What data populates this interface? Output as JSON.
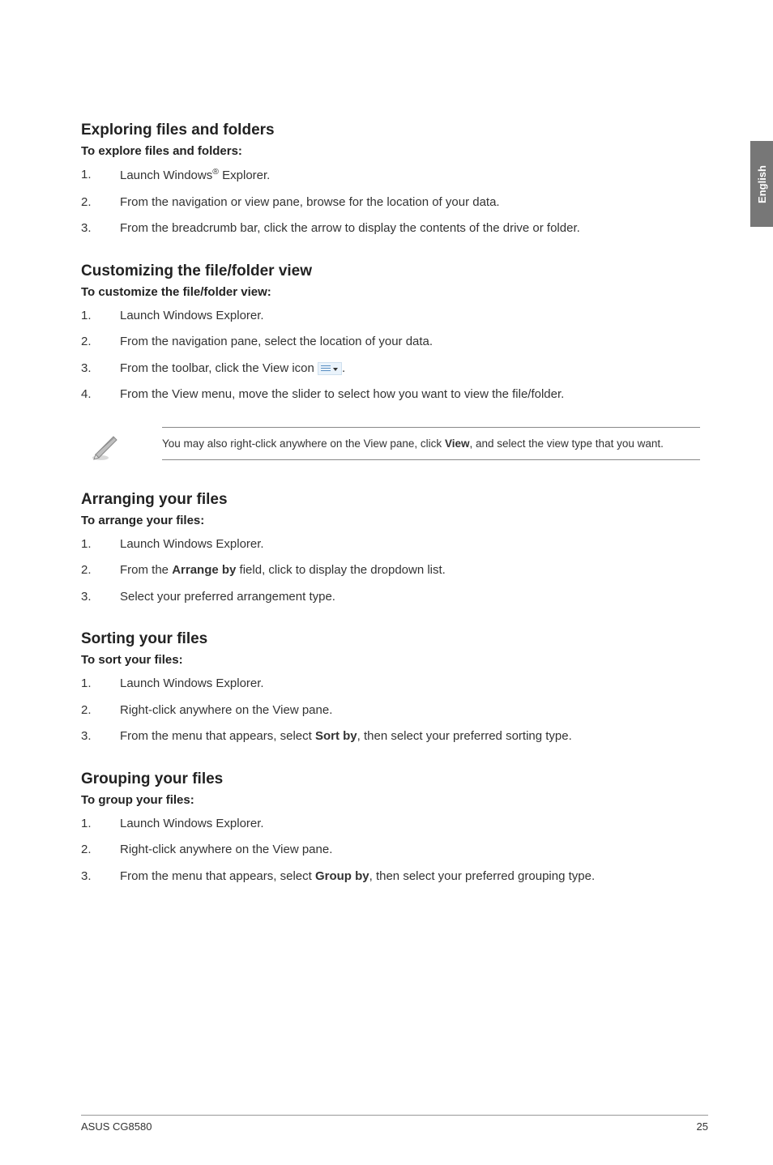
{
  "sidetab": "English",
  "sections": {
    "exploring": {
      "heading": "Exploring files and folders",
      "subhead": "To explore files and folders:",
      "steps": [
        {
          "num": "1.",
          "pre": "Launch Windows",
          "sup": "®",
          "post": " Explorer."
        },
        {
          "num": "2.",
          "text": "From the navigation or view pane, browse for the location of your data."
        },
        {
          "num": "3.",
          "text": "From the breadcrumb bar, click the arrow to display the contents of the drive or folder."
        }
      ]
    },
    "customizing": {
      "heading": "Customizing the file/folder view",
      "subhead": "To customize the file/folder view:",
      "steps": [
        {
          "num": "1.",
          "text": "Launch Windows Explorer."
        },
        {
          "num": "2.",
          "text": "From the navigation pane, select the location of your data."
        },
        {
          "num": "3.",
          "pre": "From the toolbar, click the View icon ",
          "icon": true,
          "post": "."
        },
        {
          "num": "4.",
          "text": "From the View menu, move the slider to select how you want to view the file/folder."
        }
      ],
      "note": {
        "pre": "You may also right-click anywhere on the View pane, click ",
        "bold": "View",
        "post": ", and select the view type that you want."
      }
    },
    "arranging": {
      "heading": "Arranging your files",
      "subhead": "To arrange your files:",
      "steps": [
        {
          "num": "1.",
          "text": "Launch Windows Explorer."
        },
        {
          "num": "2.",
          "pre": "From the ",
          "bold": "Arrange by",
          "post": " field, click to display the dropdown list."
        },
        {
          "num": "3.",
          "text": "Select your preferred arrangement type."
        }
      ]
    },
    "sorting": {
      "heading": "Sorting your files",
      "subhead": "To sort your files:",
      "steps": [
        {
          "num": "1.",
          "text": "Launch Windows Explorer."
        },
        {
          "num": "2.",
          "text": "Right-click anywhere on the View pane."
        },
        {
          "num": "3.",
          "pre": "From the menu that appears, select ",
          "bold": "Sort by",
          "post": ", then select your preferred sorting type."
        }
      ]
    },
    "grouping": {
      "heading": "Grouping your files",
      "subhead": "To group your files:",
      "steps": [
        {
          "num": "1.",
          "text": "Launch Windows Explorer."
        },
        {
          "num": "2.",
          "text": "Right-click anywhere on the View pane."
        },
        {
          "num": "3.",
          "pre": "From the menu that appears, select ",
          "bold": "Group by",
          "post": ", then select your preferred grouping type."
        }
      ]
    }
  },
  "footer": {
    "left": "ASUS CG8580",
    "right": "25"
  }
}
